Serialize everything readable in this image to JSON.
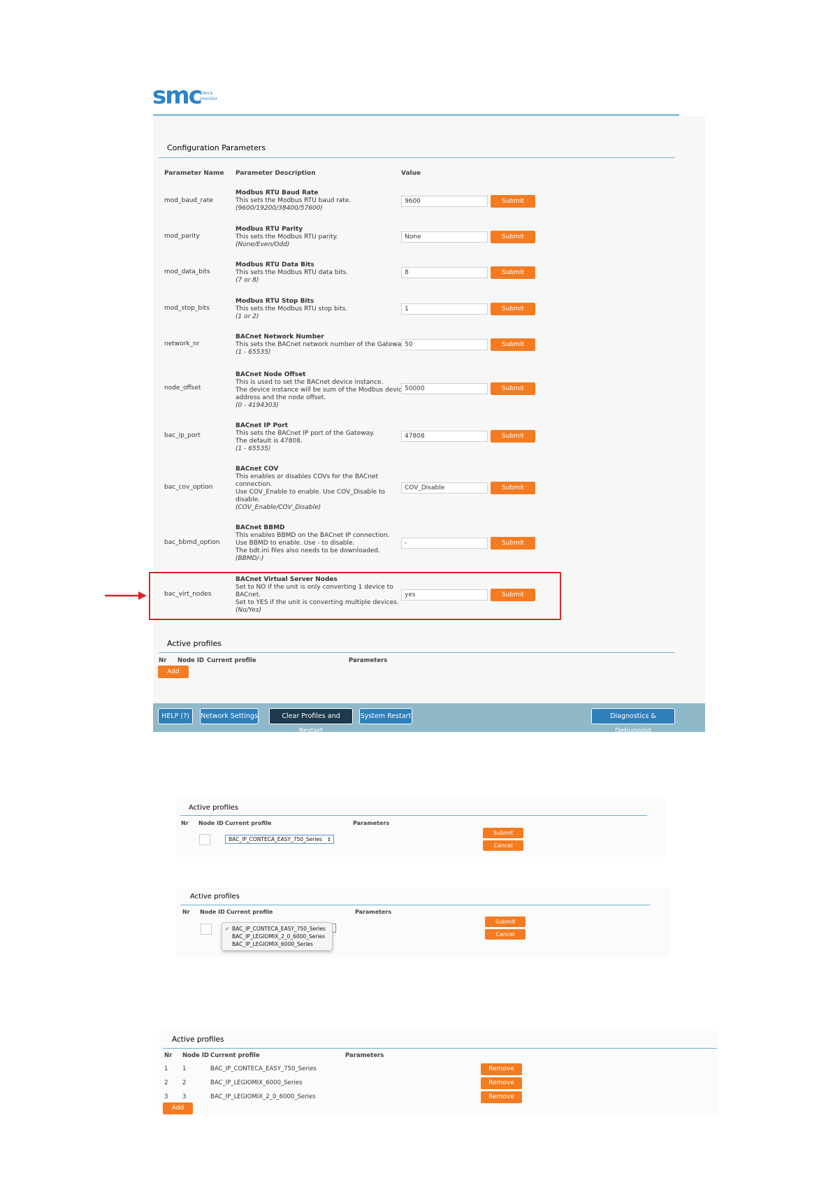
{
  "logo": {
    "text": "smc",
    "sub1": "sierra",
    "sub2": "monitor",
    "color": "#2d83c8"
  },
  "config": {
    "title": "Configuration Parameters",
    "headers": {
      "name": "Parameter Name",
      "desc": "Parameter Description",
      "value": "Value"
    },
    "submit_label": "Submit",
    "params": [
      {
        "name": "mod_baud_rate",
        "title": "Modbus RTU Baud Rate",
        "lines": [
          "This sets the Modbus RTU baud rate."
        ],
        "range": "(9600/19200/38400/57600)",
        "value": "9600"
      },
      {
        "name": "mod_parity",
        "title": "Modbus RTU Parity",
        "lines": [
          "This sets the Modbus RTU parity."
        ],
        "range": "(None/Even/Odd)",
        "value": "None"
      },
      {
        "name": "mod_data_bits",
        "title": "Modbus RTU Data Bits",
        "lines": [
          "This sets the Modbus RTU data bits."
        ],
        "range": "(7 or 8)",
        "value": "8"
      },
      {
        "name": "mod_stop_bits",
        "title": "Modbus RTU Stop Bits",
        "lines": [
          "This sets the Modbus RTU stop bits."
        ],
        "range": "(1 or 2)",
        "value": "1"
      },
      {
        "name": "network_nr",
        "title": "BACnet Network Number",
        "lines": [
          "This sets the BACnet network number of the Gateway."
        ],
        "range": "(1 - 65535)",
        "value": "50"
      },
      {
        "name": "node_offset",
        "title": "BACnet Node Offset",
        "lines": [
          "This is used to set the BACnet device instance.",
          "The device instance will be sum of the Modbus device",
          "address and the node offset."
        ],
        "range": "(0 - 4194303)",
        "value": "50000"
      },
      {
        "name": "bac_ip_port",
        "title": "BACnet IP Port",
        "lines": [
          "This sets the BACnet IP port of the Gateway.",
          "The default is 47808."
        ],
        "range": "(1 - 65535)",
        "value": "47808"
      },
      {
        "name": "bac_cov_option",
        "title": "BACnet COV",
        "lines": [
          "This enables or disables COVs for the BACnet",
          "connection.",
          "Use COV_Enable to enable. Use COV_Disable to",
          "disable."
        ],
        "range": "(COV_Enable/COV_Disable)",
        "value": "COV_Disable"
      },
      {
        "name": "bac_bbmd_option",
        "title": "BACnet BBMD",
        "lines": [
          "This enables BBMD on the BACnet IP connection.",
          "Use BBMD to enable. Use - to disable.",
          "The bdt.ini files also needs to be downloaded."
        ],
        "range": "(BBMD/-)",
        "value": "-"
      },
      {
        "name": "bac_virt_nodes",
        "title": "BACnet Virtual Server Nodes",
        "lines": [
          "Set to NO if the unit is only converting 1 device to",
          "BACnet.",
          "Set to YES if the unit is converting multiple devices."
        ],
        "range": "(No/Yes)",
        "value": "yes"
      }
    ]
  },
  "active_profiles": {
    "title": "Active profiles",
    "headers": {
      "nr": "Nr",
      "node_id": "Node ID",
      "current_profile": "Current profile",
      "parameters": "Parameters"
    },
    "add_label": "Add"
  },
  "footer": {
    "help": "HELP (?)",
    "network": "Network Settings",
    "clear": "Clear Profiles and Restart",
    "restart": "System Restart",
    "diagnostics": "Diagnostics & Debugging"
  },
  "panel2": {
    "title": "Active profiles",
    "selected_profile": "BAC_IP_CONTECA_EASY_750_Series",
    "submit_label": "Submit",
    "cancel_label": "Cancel"
  },
  "panel3": {
    "title": "Active profiles",
    "options": [
      "BAC_IP_CONTECA_EASY_750_Series",
      "BAC_IP_LEGIOMIX_2_0_6000_Series",
      "BAC_IP_LEGIOMIX_6000_Series"
    ],
    "check_mark": "✓",
    "submit_label": "Submit",
    "cancel_label": "Cancel"
  },
  "panel4": {
    "title": "Active profiles",
    "remove_label": "Remove",
    "add_label": "Add",
    "rows": [
      {
        "nr": "1",
        "node_id": "1",
        "profile": "BAC_IP_CONTECA_EASY_750_Series"
      },
      {
        "nr": "2",
        "node_id": "2",
        "profile": "BAC_IP_LEGIOMIX_6000_Series"
      },
      {
        "nr": "3",
        "node_id": "3",
        "profile": "BAC_IP_LEGIOMIX_2_0_6000_Series"
      }
    ]
  },
  "colors": {
    "accent": "#f47b20",
    "rule": "#6bb3d0",
    "footer_bar": "#8fb8c8",
    "button_blue": "#2f7fbb",
    "highlight": "#d9262b"
  }
}
